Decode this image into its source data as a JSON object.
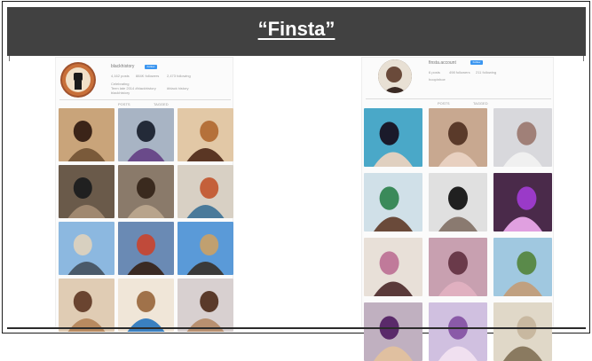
{
  "slide": {
    "title": "“Finsta”"
  },
  "profiles": [
    {
      "side": "left",
      "username": "blackhistory",
      "follow_label": "Follow",
      "stats": [
        "4,162 posts",
        "884K followers",
        "2,473 following"
      ],
      "bio": [
        "Celebrating",
        "Teen late 2014 #blackhistory",
        "#black history",
        "blackhistory"
      ],
      "tabs": [
        "POSTS",
        "TAGGED"
      ],
      "avatar_color": "#a0522d",
      "photos": [
        {
          "name": "woman-portrait",
          "colors": [
            "#c9a47a",
            "#3b2418",
            "#7a5a3a"
          ]
        },
        {
          "name": "inauguration-group",
          "colors": [
            "#a8b4c4",
            "#232a38",
            "#6a4a8a"
          ]
        },
        {
          "name": "woman-orange-outfit",
          "colors": [
            "#e2c8a6",
            "#b5713a",
            "#5a3624"
          ]
        },
        {
          "name": "men-suits-group",
          "colors": [
            "#6a5a4a",
            "#202020",
            "#a08870"
          ]
        },
        {
          "name": "elder-portrait",
          "colors": [
            "#8a7a6a",
            "#3a2a1e",
            "#b8a48c"
          ]
        },
        {
          "name": "books-stack",
          "colors": [
            "#d8d0c4",
            "#c4603a",
            "#4a7a9a"
          ]
        },
        {
          "name": "rooftop-woman",
          "colors": [
            "#8cb8e0",
            "#d8d0c0",
            "#4a5a6a"
          ]
        },
        {
          "name": "woman-red-hair",
          "colors": [
            "#6a8ab4",
            "#c04a3a",
            "#3a2a24"
          ]
        },
        {
          "name": "atv-desert",
          "colors": [
            "#5a9ad8",
            "#c0a070",
            "#3a3a3a"
          ]
        },
        {
          "name": "woman-curly-hair",
          "colors": [
            "#e0ccb4",
            "#6a4430",
            "#b88a60"
          ]
        },
        {
          "name": "wooden-bowl",
          "colors": [
            "#f0e6d8",
            "#a0724a",
            "#3a80c0"
          ]
        },
        {
          "name": "woman-crown",
          "colors": [
            "#d8d0d0",
            "#5a3a2a",
            "#b89070"
          ]
        }
      ]
    },
    {
      "side": "right",
      "username": "finsta.account",
      "follow_label": "Follow",
      "stats": [
        "6 posts",
        "498 followers",
        "211 following"
      ],
      "bio": [
        "hoopinhoe"
      ],
      "tabs": [
        "POSTS",
        "TAGGED"
      ],
      "avatar_color": "#7a6a5a",
      "photos": [
        {
          "name": "anime-portrait",
          "colors": [
            "#4aa8c8",
            "#1a1a2a",
            "#e0d0c0"
          ]
        },
        {
          "name": "woman-closeup",
          "colors": [
            "#c8a890",
            "#5a3a2a",
            "#e8d0c0"
          ]
        },
        {
          "name": "woman-silver-hair",
          "colors": [
            "#d8d8dc",
            "#a08078",
            "#f0f0f0"
          ]
        },
        {
          "name": "green-outfit-pose",
          "colors": [
            "#d0e0e8",
            "#3a8a5a",
            "#6a4a3a"
          ]
        },
        {
          "name": "fishnet-legs",
          "colors": [
            "#e0e0e0",
            "#202020",
            "#8a7a70"
          ]
        },
        {
          "name": "purple-fur",
          "colors": [
            "#4a2a4a",
            "#9a3ac8",
            "#e0a0e0"
          ]
        },
        {
          "name": "party-outfit",
          "colors": [
            "#e8e0d8",
            "#c07a9a",
            "#5a3a3a"
          ]
        },
        {
          "name": "pink-outfit",
          "colors": [
            "#c8a0b0",
            "#6a3a4a",
            "#e0b0c0"
          ]
        },
        {
          "name": "picnic-table",
          "colors": [
            "#a0c8e0",
            "#5a8a4a",
            "#c0a080"
          ]
        },
        {
          "name": "woman-purple-top",
          "colors": [
            "#c0b0c0",
            "#5a2a6a",
            "#e0c0a0"
          ]
        },
        {
          "name": "purple-wig",
          "colors": [
            "#d0c0e0",
            "#8a5aa8",
            "#f0e0f0"
          ]
        },
        {
          "name": "heels-shoes",
          "colors": [
            "#e0d8c8",
            "#c8b8a0",
            "#8a7a60"
          ]
        }
      ]
    }
  ]
}
